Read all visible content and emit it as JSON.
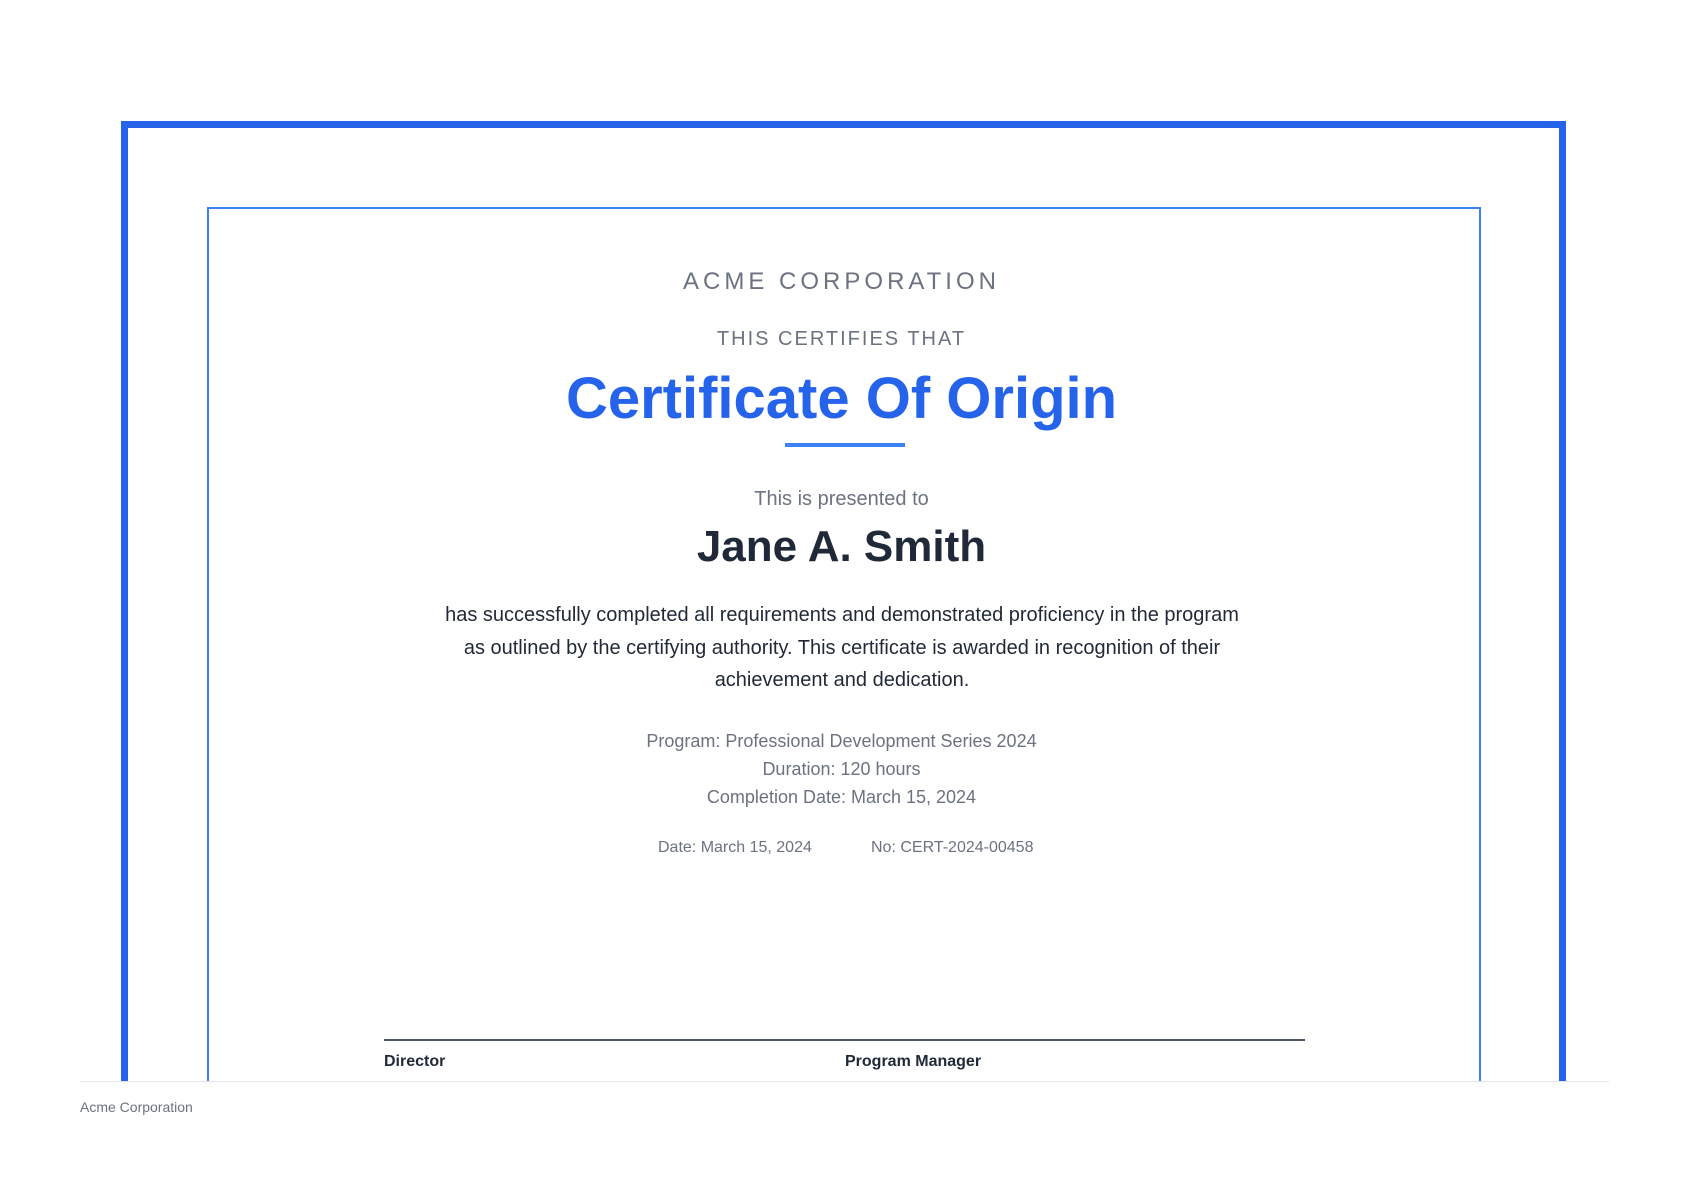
{
  "certificate": {
    "organization": "ACME CORPORATION",
    "certifies_line": "THIS CERTIFIES THAT",
    "title": "Certificate Of Origin",
    "presented_line": "This is presented to",
    "recipient": "Jane A. Smith",
    "body": "has successfully completed all requirements and demonstrated proficiency in the program as outlined by the certifying authority. This certificate is awarded in recognition of their achievement and dedication.",
    "details": {
      "program": "Program: Professional Development Series 2024",
      "duration": "Duration: 120 hours",
      "completion": "Completion Date: March 15, 2024"
    },
    "meta": {
      "date": "Date: March 15, 2024",
      "number": "No: CERT-2024-00458"
    },
    "signatures": {
      "director": "Director",
      "manager": "Program Manager"
    }
  },
  "footer": {
    "text": "Acme Corporation"
  },
  "colors": {
    "accent": "#2563eb",
    "text_dark": "#1f2937",
    "text_muted": "#6b7280"
  }
}
